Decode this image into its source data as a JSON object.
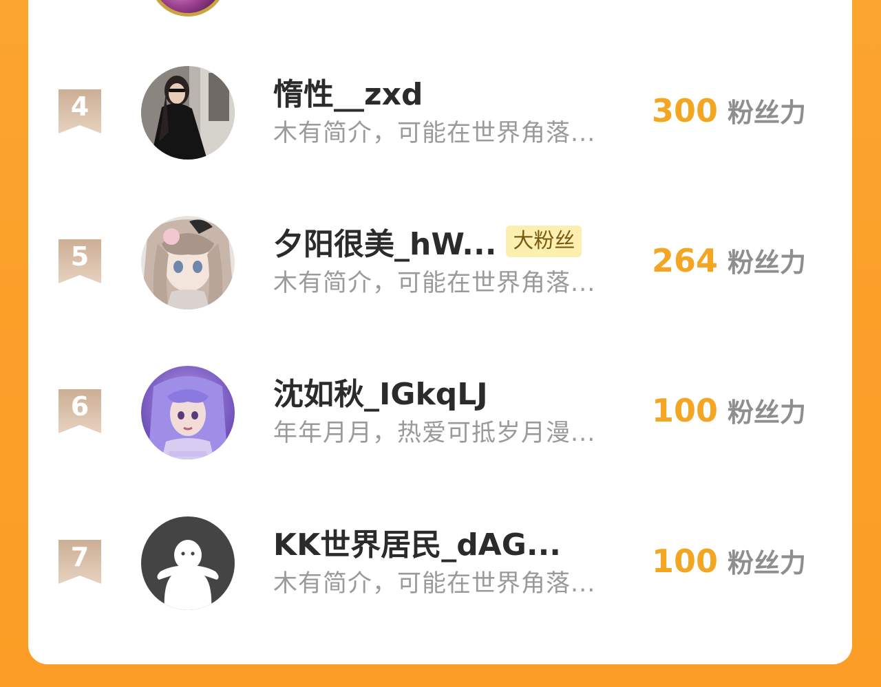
{
  "colors": {
    "background": "#fba42e",
    "card": "#ffffff",
    "rank_ribbon": "#d9bca2",
    "score": "#f2a623",
    "name": "#2b2b2b",
    "desc": "#9a9a9a",
    "badge_bg": "#fcefb0"
  },
  "ranking": {
    "rows": [
      {
        "rank": "4",
        "name": "惰性__zxd",
        "badge": "",
        "desc": "木有简介，可能在世界角落...",
        "score": "300",
        "unit": "粉丝力",
        "avatar_icon": "avatar-photo-icon"
      },
      {
        "rank": "5",
        "name": "夕阳很美_hW...",
        "badge": "大粉丝",
        "desc": "木有简介，可能在世界角落...",
        "score": "264",
        "unit": "粉丝力",
        "avatar_icon": "avatar-anime-icon"
      },
      {
        "rank": "6",
        "name": "沈如秋_IGkqLJ",
        "badge": "",
        "desc": "年年月月，热爱可抵岁月漫...",
        "score": "100",
        "unit": "粉丝力",
        "avatar_icon": "avatar-anime-icon"
      },
      {
        "rank": "7",
        "name": "KK世界居民_dAG...",
        "badge": "",
        "desc": "木有简介，可能在世界角落...",
        "score": "100",
        "unit": "粉丝力",
        "avatar_icon": "default-avatar-icon"
      }
    ]
  }
}
